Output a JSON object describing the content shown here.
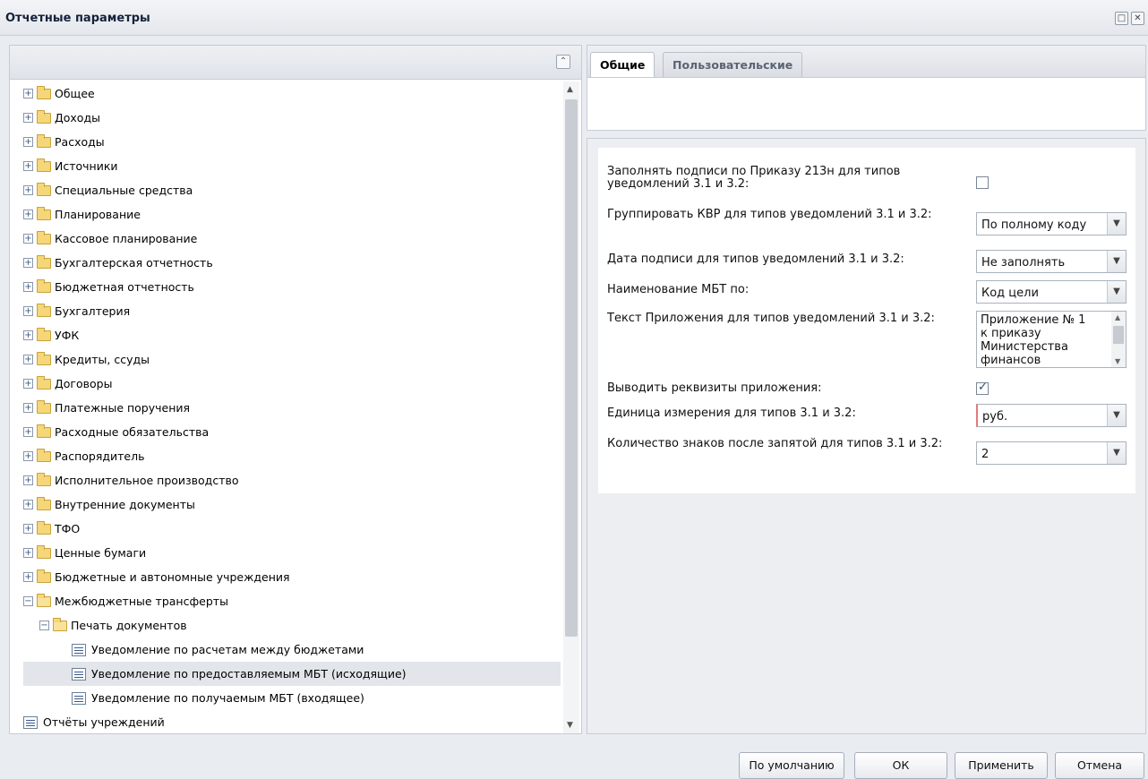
{
  "window": {
    "title": "Отчетные параметры",
    "max_glyph": "□",
    "close_glyph": "✕"
  },
  "tree": {
    "collapse_glyph": "⌃",
    "items": [
      {
        "label": "Общее",
        "level": 0,
        "type": "folder",
        "expanded": false
      },
      {
        "label": "Доходы",
        "level": 0,
        "type": "folder",
        "expanded": false
      },
      {
        "label": "Расходы",
        "level": 0,
        "type": "folder",
        "expanded": false
      },
      {
        "label": "Источники",
        "level": 0,
        "type": "folder",
        "expanded": false
      },
      {
        "label": "Специальные средства",
        "level": 0,
        "type": "folder",
        "expanded": false
      },
      {
        "label": "Планирование",
        "level": 0,
        "type": "folder",
        "expanded": false
      },
      {
        "label": "Кассовое планирование",
        "level": 0,
        "type": "folder",
        "expanded": false
      },
      {
        "label": "Бухгалтерская отчетность",
        "level": 0,
        "type": "folder",
        "expanded": false
      },
      {
        "label": "Бюджетная отчетность",
        "level": 0,
        "type": "folder",
        "expanded": false
      },
      {
        "label": "Бухгалтерия",
        "level": 0,
        "type": "folder",
        "expanded": false
      },
      {
        "label": "УФК",
        "level": 0,
        "type": "folder",
        "expanded": false
      },
      {
        "label": "Кредиты, ссуды",
        "level": 0,
        "type": "folder",
        "expanded": false
      },
      {
        "label": "Договоры",
        "level": 0,
        "type": "folder",
        "expanded": false
      },
      {
        "label": "Платежные поручения",
        "level": 0,
        "type": "folder",
        "expanded": false
      },
      {
        "label": "Расходные обязательства",
        "level": 0,
        "type": "folder",
        "expanded": false
      },
      {
        "label": "Распорядитель",
        "level": 0,
        "type": "folder",
        "expanded": false
      },
      {
        "label": "Исполнительное производство",
        "level": 0,
        "type": "folder",
        "expanded": false
      },
      {
        "label": "Внутренние документы",
        "level": 0,
        "type": "folder",
        "expanded": false
      },
      {
        "label": "ТФО",
        "level": 0,
        "type": "folder",
        "expanded": false
      },
      {
        "label": "Ценные бумаги",
        "level": 0,
        "type": "folder",
        "expanded": false
      },
      {
        "label": "Бюджетные и автономные учреждения",
        "level": 0,
        "type": "folder",
        "expanded": false
      },
      {
        "label": "Межбюджетные трансферты",
        "level": 0,
        "type": "folder",
        "expanded": true
      },
      {
        "label": "Печать документов",
        "level": 1,
        "type": "folder",
        "expanded": true
      },
      {
        "label": "Уведомление по расчетам между бюджетами",
        "level": 2,
        "type": "report"
      },
      {
        "label": "Уведомление по предоставляемым МБТ (исходящие)",
        "level": 2,
        "type": "report",
        "selected": true
      },
      {
        "label": "Уведомление по получаемым МБТ (входящее)",
        "level": 2,
        "type": "report"
      },
      {
        "label": "Отчёты учреждений",
        "level": 0,
        "type": "report"
      }
    ]
  },
  "tabs": {
    "general": "Общие",
    "custom": "Пользовательские"
  },
  "form": {
    "row1_label": "Заполнять подписи по Приказу 213н для типов уведомлений 3.1 и 3.2:",
    "row1_checked": false,
    "row2_label": "Группировать КВР для типов уведомлений 3.1 и 3.2:",
    "row2_value": "По полному коду",
    "row3_label": "Дата подписи для типов уведомлений 3.1 и 3.2:",
    "row3_value": "Не заполнять",
    "row4_label": "Наименование МБТ по:",
    "row4_value": "Код цели",
    "row5_label": "Текст Приложения для типов уведомлений 3.1 и 3.2:",
    "row5_value": "Приложение № 1\nк приказу\nМинистерства\nфинансов",
    "row6_label": "Выводить реквизиты приложения:",
    "row6_checked": true,
    "row7_label": "Единица измерения для типов 3.1 и 3.2:",
    "row7_value": "руб.",
    "row8_label": "Количество знаков после запятой для типов 3.1 и 3.2:",
    "row8_value": "2"
  },
  "icons": {
    "dropdown": "chevron-down-icon",
    "expander_plus": "⊞",
    "expander_minus": "⊟"
  },
  "buttons": {
    "default": "По умолчанию",
    "ok": "ОК",
    "apply": "Применить",
    "cancel": "Отмена"
  }
}
